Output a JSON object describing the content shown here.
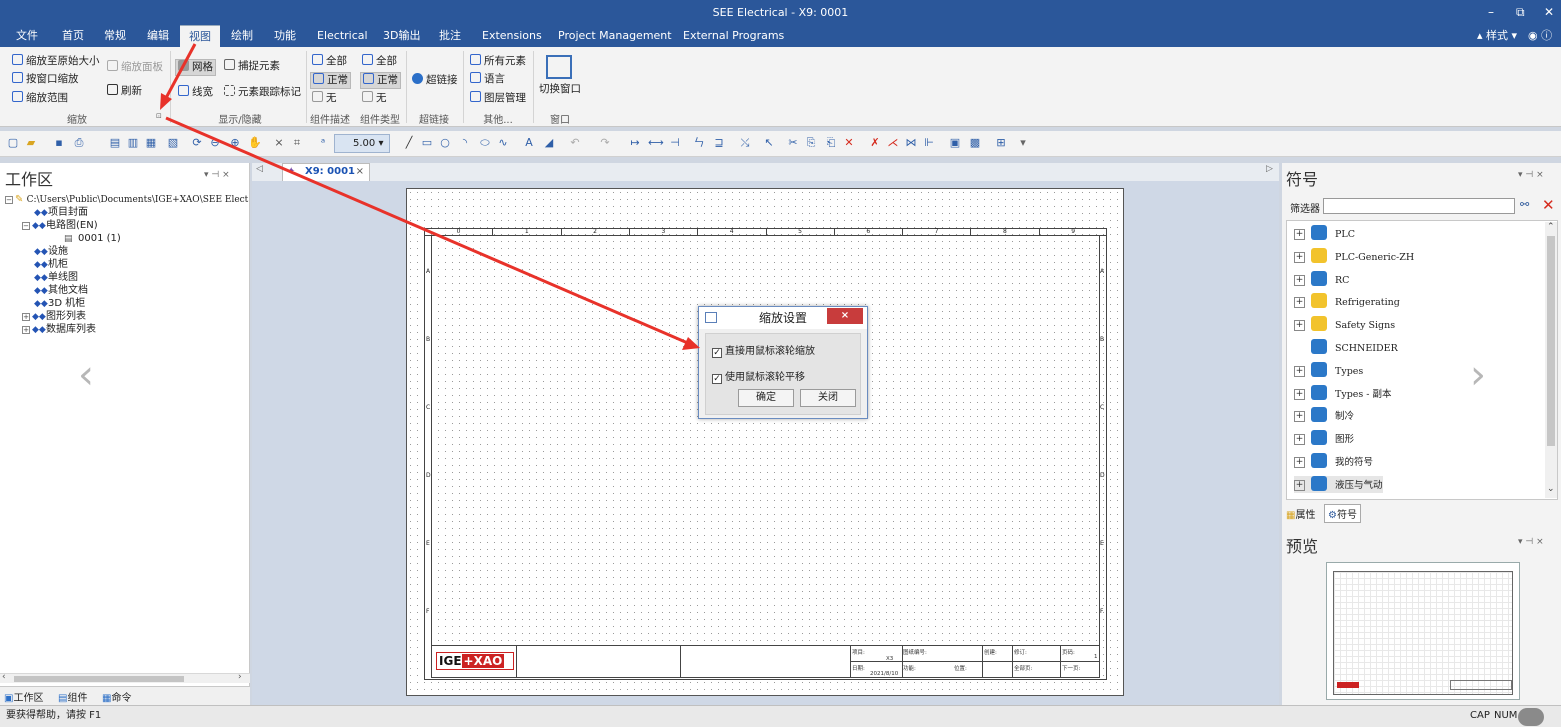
{
  "app": {
    "title": "SEE Electrical - X9: 0001"
  },
  "menu": {
    "items": [
      "文件",
      "首页",
      "常规",
      "编辑",
      "视图",
      "绘制",
      "功能",
      "Electrical",
      "3D输出",
      "批注",
      "Extensions",
      "Project Management",
      "External Programs"
    ],
    "right_style": "▴ 样式 ▾"
  },
  "ribbon": {
    "zoom": {
      "fit_original": "缩放至原始大小",
      "window_zoom": "按窗口缩放",
      "zoom_range": "缩放范围",
      "zoom_panel": "缩放面板",
      "refresh": "刷新",
      "group": "缩放"
    },
    "display": {
      "grid": "网格",
      "snap": "捕捉元素",
      "linewidth": "线宽",
      "trace": "元素跟踪标记",
      "group": "显示/隐藏"
    },
    "comp_desc": {
      "all": "全部",
      "normal": "正常",
      "none": "无",
      "group": "组件描述"
    },
    "comp_type": {
      "all": "全部",
      "normal": "正常",
      "none": "无",
      "group": "组件类型"
    },
    "hyperlink": {
      "label": "超链接",
      "group": "超链接"
    },
    "other": {
      "all_elements": "所有元素",
      "language": "语言",
      "layer_mgmt": "图层管理",
      "group": "其他..."
    },
    "window": {
      "switch": "切换窗口",
      "group": "窗口"
    }
  },
  "toolbar": {
    "zoom_value": "5.00"
  },
  "workspace": {
    "title": "工作区",
    "root": "C:\\Users\\Public\\Documents\\IGE+XAO\\SEE Elect",
    "items": [
      {
        "label": "项目封面",
        "indent": 1,
        "exp": ""
      },
      {
        "label": "电路图(EN)",
        "indent": 1,
        "exp": "−"
      },
      {
        "label": "0001  (1)",
        "indent": 2,
        "exp": ""
      },
      {
        "label": "设施",
        "indent": 1,
        "exp": ""
      },
      {
        "label": "机柜",
        "indent": 1,
        "exp": ""
      },
      {
        "label": "单线图",
        "indent": 1,
        "exp": ""
      },
      {
        "label": "其他文档",
        "indent": 1,
        "exp": ""
      },
      {
        "label": "3D 机柜",
        "indent": 1,
        "exp": ""
      },
      {
        "label": "图形列表",
        "indent": 1,
        "exp": "+"
      },
      {
        "label": "数据库列表",
        "indent": 1,
        "exp": "+"
      }
    ],
    "tabs": [
      "工作区",
      "组件",
      "命令"
    ]
  },
  "document": {
    "tab": "X9: 0001",
    "columns": [
      "0",
      "1",
      "2",
      "3",
      "4",
      "5",
      "6",
      "7",
      "8",
      "9"
    ],
    "rows": [
      "A",
      "B",
      "C",
      "D",
      "E",
      "F"
    ],
    "logo": "IGE+XAO",
    "titleblock": {
      "proj": "项目:",
      "x3": "X3",
      "drawing_no": "图纸编号:",
      "date_label": "日期:",
      "date": "2021/8/10",
      "func": "功能:",
      "pos": "位置:",
      "full_page": "全部页:",
      "next": "下一页:",
      "create": "创建:",
      "mod": "修订:",
      "page": "页码:",
      "page_num": "1"
    }
  },
  "dialog": {
    "title": "缩放设置",
    "close": "×",
    "options": [
      {
        "label": "直接用鼠标滚轮缩放",
        "checked": true
      },
      {
        "label": "使用鼠标滚轮平移",
        "checked": true
      }
    ],
    "ok": "确定",
    "cancel": "关闭"
  },
  "symbols": {
    "title": "符号",
    "filter_label": "筛选器",
    "items": [
      {
        "label": "PLC",
        "expand": true,
        "color": "blue"
      },
      {
        "label": "PLC-Generic-ZH",
        "expand": true,
        "color": "yellow"
      },
      {
        "label": "RC",
        "expand": true,
        "color": "blue"
      },
      {
        "label": "Refrigerating",
        "expand": true,
        "color": "yellow"
      },
      {
        "label": "Safety Signs",
        "expand": true,
        "color": "yellow"
      },
      {
        "label": "SCHNEIDER",
        "expand": false,
        "color": "blue"
      },
      {
        "label": "Types",
        "expand": true,
        "color": "blue"
      },
      {
        "label": "Types - 副本",
        "expand": true,
        "color": "blue"
      },
      {
        "label": "制冷",
        "expand": true,
        "color": "blue"
      },
      {
        "label": "图形",
        "expand": true,
        "color": "blue"
      },
      {
        "label": "我的符号",
        "expand": true,
        "color": "blue"
      },
      {
        "label": "液压与气动",
        "expand": true,
        "color": "blue"
      }
    ],
    "tabs": [
      "属性",
      "符号"
    ]
  },
  "preview": {
    "title": "预览"
  },
  "status": {
    "help": "要获得帮助，请按 F1",
    "cap": "CAP",
    "num": "NUM"
  },
  "colors": {
    "accent": "#2b579a",
    "arrow": "#e8322a",
    "close": "#c83c3c"
  }
}
